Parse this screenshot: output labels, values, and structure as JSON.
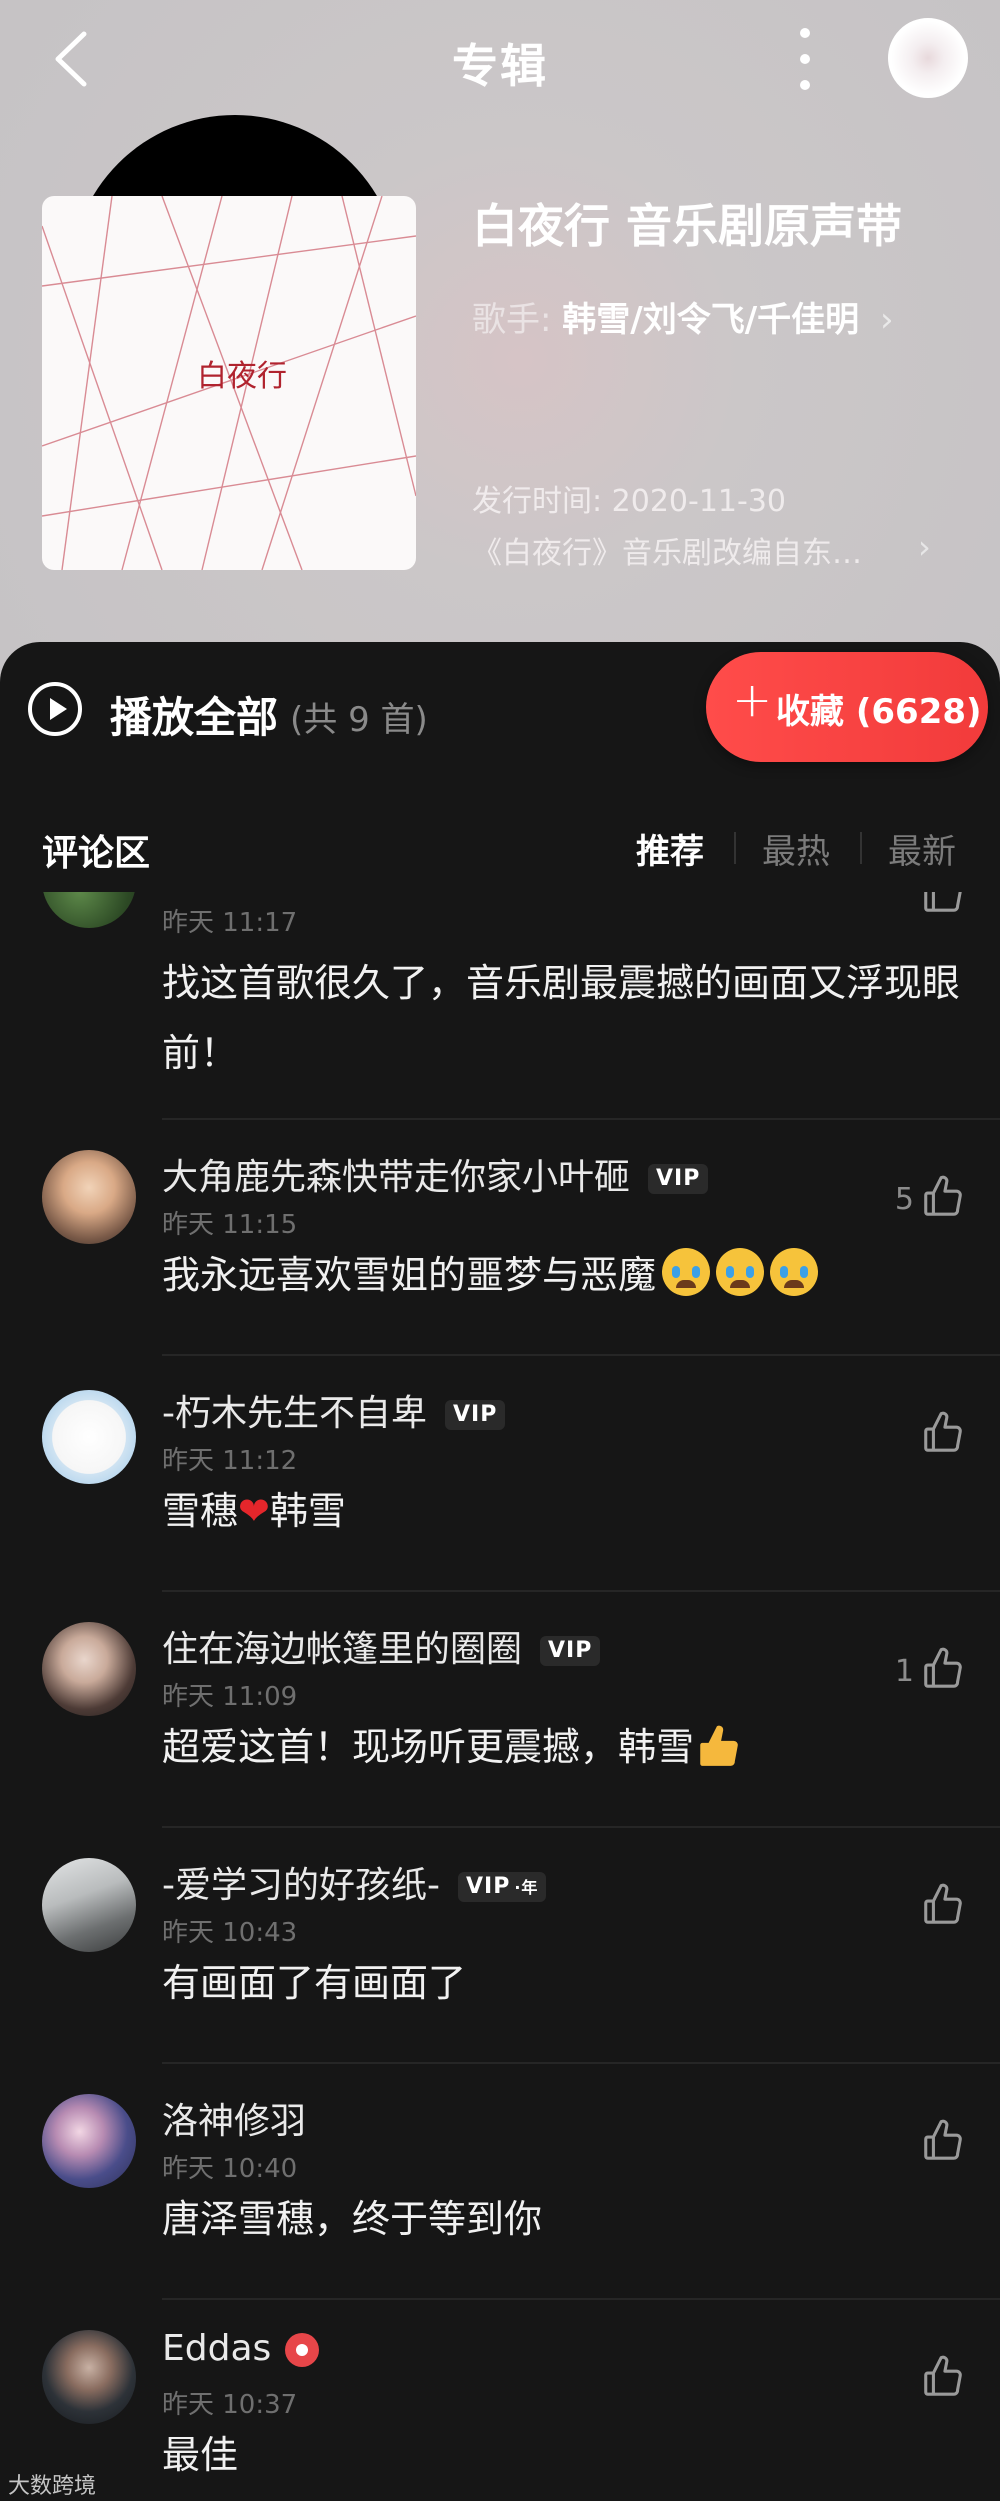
{
  "nav": {
    "title": "专辑"
  },
  "album": {
    "title": "白夜行 音乐剧原声带",
    "artist_label": "歌手:",
    "artists": "韩雪/刘令飞/千佳明",
    "release_date": "发行时间: 2020-11-30",
    "description": "《白夜行》音乐剧改编自东…",
    "cover_title": "白夜行"
  },
  "actions": {
    "play_all_label": "播放全部",
    "play_all_count": "(共 9 首)",
    "favorite_label": "收藏 (6628)"
  },
  "comments_section": {
    "title": "评论区",
    "sort_tabs": [
      "推荐",
      "最热",
      "最新"
    ],
    "active_sort": "推荐"
  },
  "comments": [
    {
      "username": "",
      "time": "昨天 11:17",
      "text": "找这首歌很久了，音乐剧最震撼的画面又浮现眼前！",
      "likes": ""
    },
    {
      "username": "大角鹿先森快带走你家小叶砸",
      "badge": "VIP",
      "time": "昨天 11:15",
      "text": "我永远喜欢雪姐的噩梦与恶魔",
      "likes": "5"
    },
    {
      "username": "-朽木先生不自卑",
      "badge": "VIP",
      "time": "昨天 11:12",
      "text_before": "雪穗",
      "text_emoji": "❤",
      "text_after": "韩雪",
      "likes": ""
    },
    {
      "username": "住在海边帐篷里的圈圈",
      "badge": "VIP",
      "time": "昨天 11:09",
      "text": "超爱这首！现场听更震撼，韩雪",
      "likes": "1"
    },
    {
      "username": "-爱学习的好孩纸-",
      "badge": "VIP",
      "badge_suffix": "·年",
      "time": "昨天 10:43",
      "text": "有画面了有画面了",
      "likes": ""
    },
    {
      "username": "洛神修羽",
      "time": "昨天 10:40",
      "text": "唐泽雪穗，终于等到你",
      "likes": ""
    },
    {
      "username": "Eddas",
      "time": "昨天 10:37",
      "text": "最佳",
      "likes": ""
    }
  ],
  "watermark": "大数跨境",
  "colors": {
    "accent": "#f23b3b",
    "panel": "#161616",
    "header": "#c9c6c8"
  }
}
